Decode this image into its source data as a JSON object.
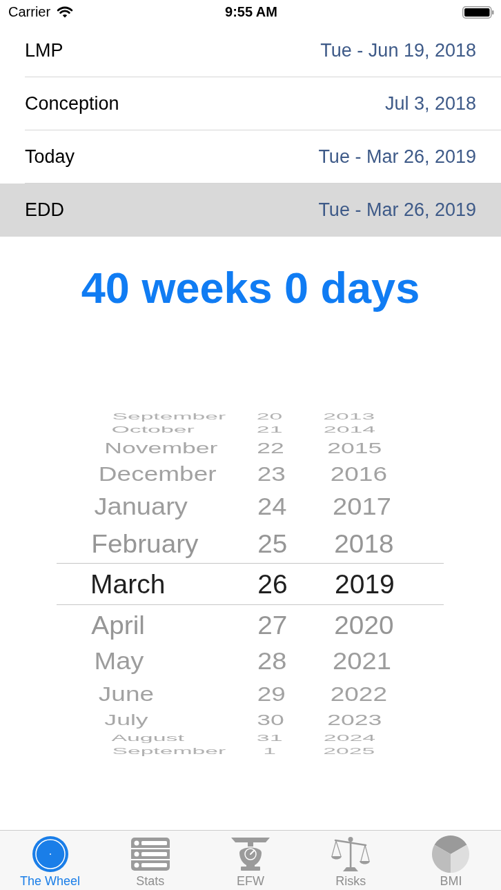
{
  "status_bar": {
    "carrier": "Carrier",
    "time": "9:55 AM"
  },
  "dates": [
    {
      "label": "LMP",
      "value": "Tue - Jun 19, 2018",
      "selected": false
    },
    {
      "label": "Conception",
      "value": "Jul 3, 2018",
      "selected": false
    },
    {
      "label": "Today",
      "value": "Tue - Mar 26, 2019",
      "selected": false
    },
    {
      "label": "EDD",
      "value": "Tue - Mar 26, 2019",
      "selected": true
    }
  ],
  "gestational_age": "40 weeks 0 days",
  "date_picker": {
    "columns": [
      {
        "items": [
          {
            "label": "September",
            "selected": false
          },
          {
            "label": "October",
            "selected": false
          },
          {
            "label": "November",
            "selected": false
          },
          {
            "label": "December",
            "selected": false
          },
          {
            "label": "January",
            "selected": false
          },
          {
            "label": "February",
            "selected": false
          },
          {
            "label": "March",
            "selected": true
          },
          {
            "label": "April",
            "selected": false
          },
          {
            "label": "May",
            "selected": false
          },
          {
            "label": "June",
            "selected": false
          },
          {
            "label": "July",
            "selected": false
          },
          {
            "label": "August",
            "selected": false
          },
          {
            "label": "September",
            "selected": false
          }
        ]
      },
      {
        "items": [
          {
            "label": "20",
            "selected": false
          },
          {
            "label": "21",
            "selected": false
          },
          {
            "label": "22",
            "selected": false
          },
          {
            "label": "23",
            "selected": false
          },
          {
            "label": "24",
            "selected": false
          },
          {
            "label": "25",
            "selected": false
          },
          {
            "label": "26",
            "selected": true
          },
          {
            "label": "27",
            "selected": false
          },
          {
            "label": "28",
            "selected": false
          },
          {
            "label": "29",
            "selected": false
          },
          {
            "label": "30",
            "selected": false
          },
          {
            "label": "31",
            "selected": false
          },
          {
            "label": "1",
            "selected": false
          }
        ]
      },
      {
        "items": [
          {
            "label": "2013",
            "selected": false
          },
          {
            "label": "2014",
            "selected": false
          },
          {
            "label": "2015",
            "selected": false
          },
          {
            "label": "2016",
            "selected": false
          },
          {
            "label": "2017",
            "selected": false
          },
          {
            "label": "2018",
            "selected": false
          },
          {
            "label": "2019",
            "selected": true
          },
          {
            "label": "2020",
            "selected": false
          },
          {
            "label": "2021",
            "selected": false
          },
          {
            "label": "2022",
            "selected": false
          },
          {
            "label": "2023",
            "selected": false
          },
          {
            "label": "2024",
            "selected": false
          },
          {
            "label": "2025",
            "selected": false
          }
        ]
      }
    ]
  },
  "tab_bar": [
    {
      "label": "The Wheel",
      "selected": true
    },
    {
      "label": "Stats",
      "selected": false
    },
    {
      "label": "EFW",
      "selected": false
    },
    {
      "label": "Risks",
      "selected": false
    },
    {
      "label": "BMI",
      "selected": false
    }
  ]
}
